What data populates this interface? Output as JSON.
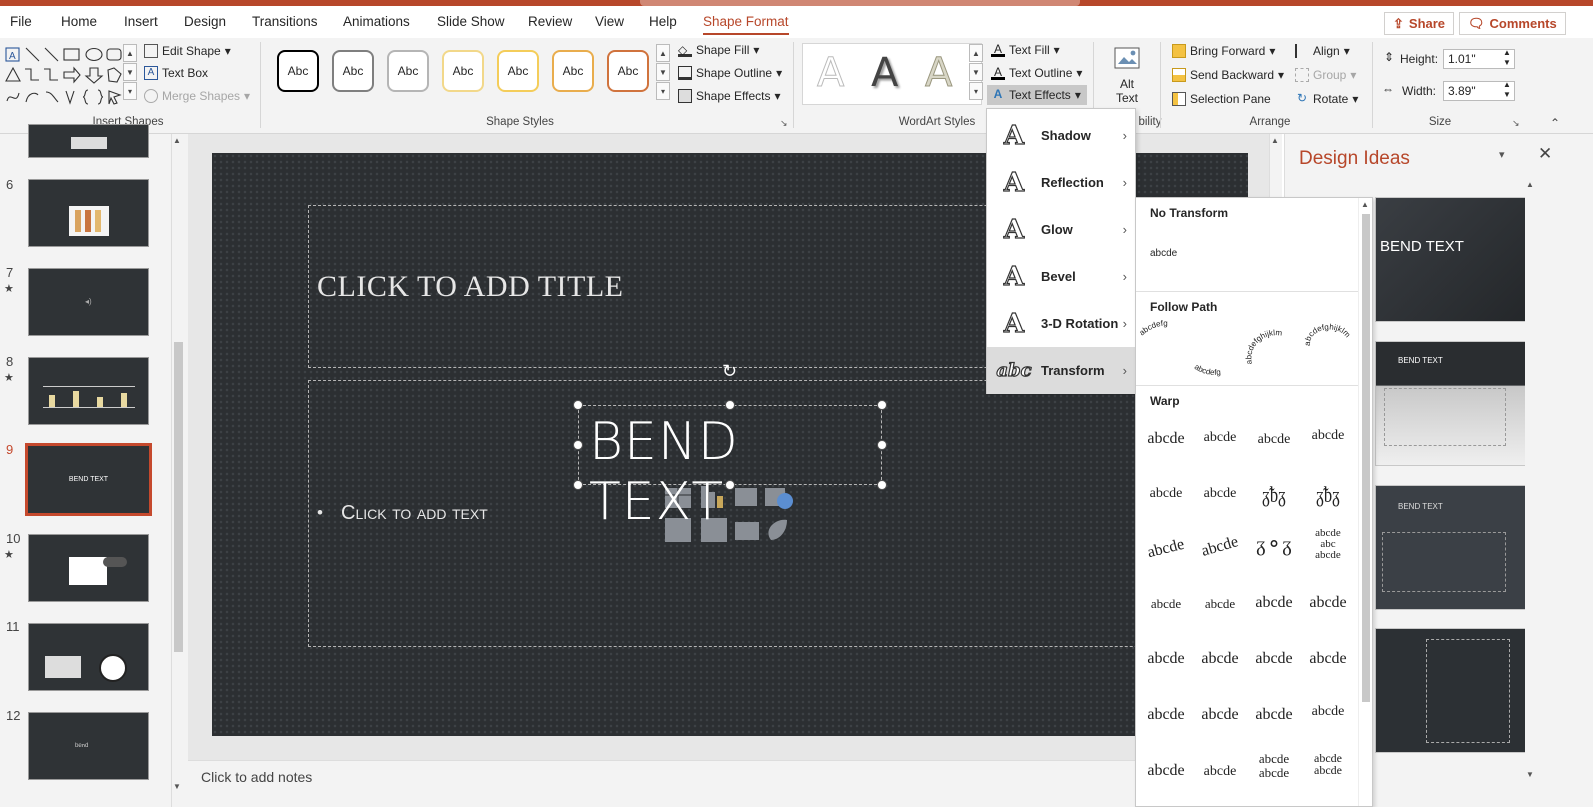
{
  "tabs": [
    "File",
    "Home",
    "Insert",
    "Design",
    "Transitions",
    "Animations",
    "Slide Show",
    "Review",
    "View",
    "Help",
    "Shape Format"
  ],
  "active_tab": "Shape Format",
  "share_label": "Share",
  "comments_label": "Comments",
  "ribbon": {
    "insert_shapes": {
      "label": "Insert Shapes",
      "edit_shape": "Edit Shape",
      "text_box": "Text Box",
      "merge_shapes": "Merge Shapes"
    },
    "shape_styles": {
      "label": "Shape Styles",
      "sample": "Abc",
      "shape_fill": "Shape Fill",
      "shape_outline": "Shape Outline",
      "shape_effects": "Shape Effects",
      "border_colors": [
        "#000000",
        "#7f7f7f",
        "#a5a5a5",
        "#ffc000",
        "#ffc000",
        "#ed7d31",
        "#c55a11"
      ]
    },
    "wordart": {
      "label": "WordArt Styles",
      "text_fill": "Text Fill",
      "text_outline": "Text Outline",
      "text_effects": "Text Effects"
    },
    "accessibility": {
      "label": "bility",
      "alt_text_1": "Alt",
      "alt_text_2": "Text"
    },
    "arrange": {
      "label": "Arrange",
      "bring_forward": "Bring Forward",
      "send_backward": "Send Backward",
      "selection_pane": "Selection Pane",
      "align": "Align",
      "group": "Group",
      "rotate": "Rotate"
    },
    "size": {
      "label": "Size",
      "height_label": "Height:",
      "height": "1.01\"",
      "width_label": "Width:",
      "width": "3.89\""
    }
  },
  "slides": [
    {
      "num": "6",
      "star": false
    },
    {
      "num": "7",
      "star": true
    },
    {
      "num": "8",
      "star": true
    },
    {
      "num": "9",
      "star": false,
      "text": "BEND TEXT"
    },
    {
      "num": "10",
      "star": true
    },
    {
      "num": "11",
      "star": false
    },
    {
      "num": "12",
      "star": false
    }
  ],
  "slide": {
    "title_placeholder": "CLICK TO ADD TITLE",
    "body_placeholder": "Click to add text",
    "body_bullet": "•",
    "wordart_text": "BEND TEXT"
  },
  "notes_placeholder": "Click to add notes",
  "text_effects_menu": [
    "Shadow",
    "Reflection",
    "Glow",
    "Bevel",
    "3-D Rotation",
    "Transform"
  ],
  "text_effects_icon_letter": "A",
  "transform_icon_text": "abc",
  "transform_menu": {
    "no_transform": "No Transform",
    "no_transform_sample": "abcde",
    "follow_path": "Follow Path",
    "warp": "Warp",
    "warp_sample": "abcde",
    "path_samples": [
      "abcdefg",
      "abcdefg",
      "abcdefghijklm",
      "abcdefghijklm"
    ]
  },
  "design_ideas": {
    "title": "Design Ideas",
    "idea1_text": "BEND TEXT",
    "idea2_text": "BEND TEXT",
    "idea3_text": "BEND TEXT"
  }
}
